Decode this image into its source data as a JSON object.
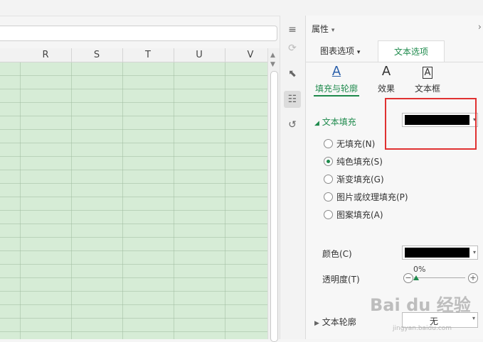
{
  "sheet": {
    "columns": [
      "R",
      "S",
      "T",
      "U",
      "V"
    ]
  },
  "panel": {
    "title": "属性",
    "title_caret": "▾",
    "close": "›",
    "tabs": [
      {
        "label": "图表选项",
        "caret": "▾"
      },
      {
        "label": "文本选项"
      }
    ],
    "subtabs": [
      {
        "label": "填充与轮廓",
        "icon": "A"
      },
      {
        "label": "效果",
        "icon": "A"
      },
      {
        "label": "文本框",
        "icon": "A"
      }
    ],
    "text_fill": {
      "label": "文本填充",
      "color": "#000000",
      "options": [
        {
          "label": "无填充(N)",
          "checked": false
        },
        {
          "label": "纯色填充(S)",
          "checked": true
        },
        {
          "label": "渐变填充(G)",
          "checked": false
        },
        {
          "label": "图片或纹理填充(P)",
          "checked": false
        },
        {
          "label": "图案填充(A)",
          "checked": false
        }
      ],
      "color_label": "颜色(C)",
      "color_value": "#000000",
      "transparency_label": "透明度(T)",
      "transparency_value": "0%"
    },
    "text_outline": {
      "label": "文本轮廓",
      "value": "无"
    }
  },
  "watermark": {
    "main": "Bai du 经验",
    "url": "jingyan.baidu.com"
  },
  "colors": {
    "accent": "#1e8a4c",
    "highlight": "#e03131",
    "grid": "#d6ecd6"
  }
}
